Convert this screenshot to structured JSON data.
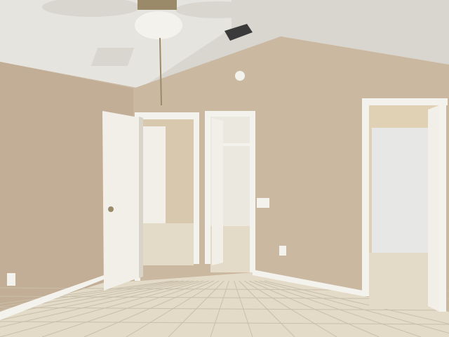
{
  "scene": {
    "colors": {
      "wall_left": "#c2ae96",
      "wall_right": "#cbb8a0",
      "wall_shadow": "#b8a48c",
      "ceiling": "#e6e4de",
      "ceiling_dark": "#d9d6cf",
      "floor": "#e3dac7",
      "floor_grout": "#c9bfaa",
      "trim": "#f4f2ec",
      "door": "#f1efe8",
      "door_edge": "#d8d4c9",
      "hall_wall": "#d7c8ae",
      "closet_wall": "#ebe8df",
      "bath_wall": "#e1d1b4",
      "shower_glass": "#e7e8e6",
      "vent": "#3a3a3a",
      "knob": "#9a8a6a"
    },
    "objects": [
      "ceiling-fan",
      "light-fixture",
      "pull-chain",
      "ceiling-vent",
      "attic-hatch",
      "smoke-detector",
      "bedroom-door",
      "hallway-doorway",
      "closet-doorway",
      "bathroom-doorway",
      "shower-enclosure",
      "light-switch",
      "outlet-left",
      "outlet-right",
      "tile-floor",
      "baseboard"
    ]
  }
}
